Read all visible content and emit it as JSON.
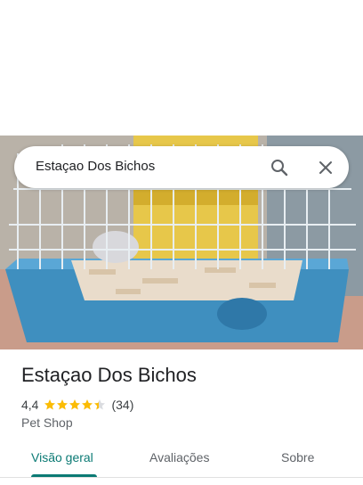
{
  "search": {
    "query": "Estaçao Dos Bichos"
  },
  "place": {
    "title": "Estaçao Dos Bichos",
    "rating": "4,4",
    "stars": 4.4,
    "review_count": "(34)",
    "category": "Pet Shop"
  },
  "tabs": [
    {
      "label": "Visão geral",
      "active": true
    },
    {
      "label": "Avaliações",
      "active": false
    },
    {
      "label": "Sobre",
      "active": false
    }
  ],
  "colors": {
    "accent": "#0b7a74",
    "star": "#fbbc04"
  }
}
